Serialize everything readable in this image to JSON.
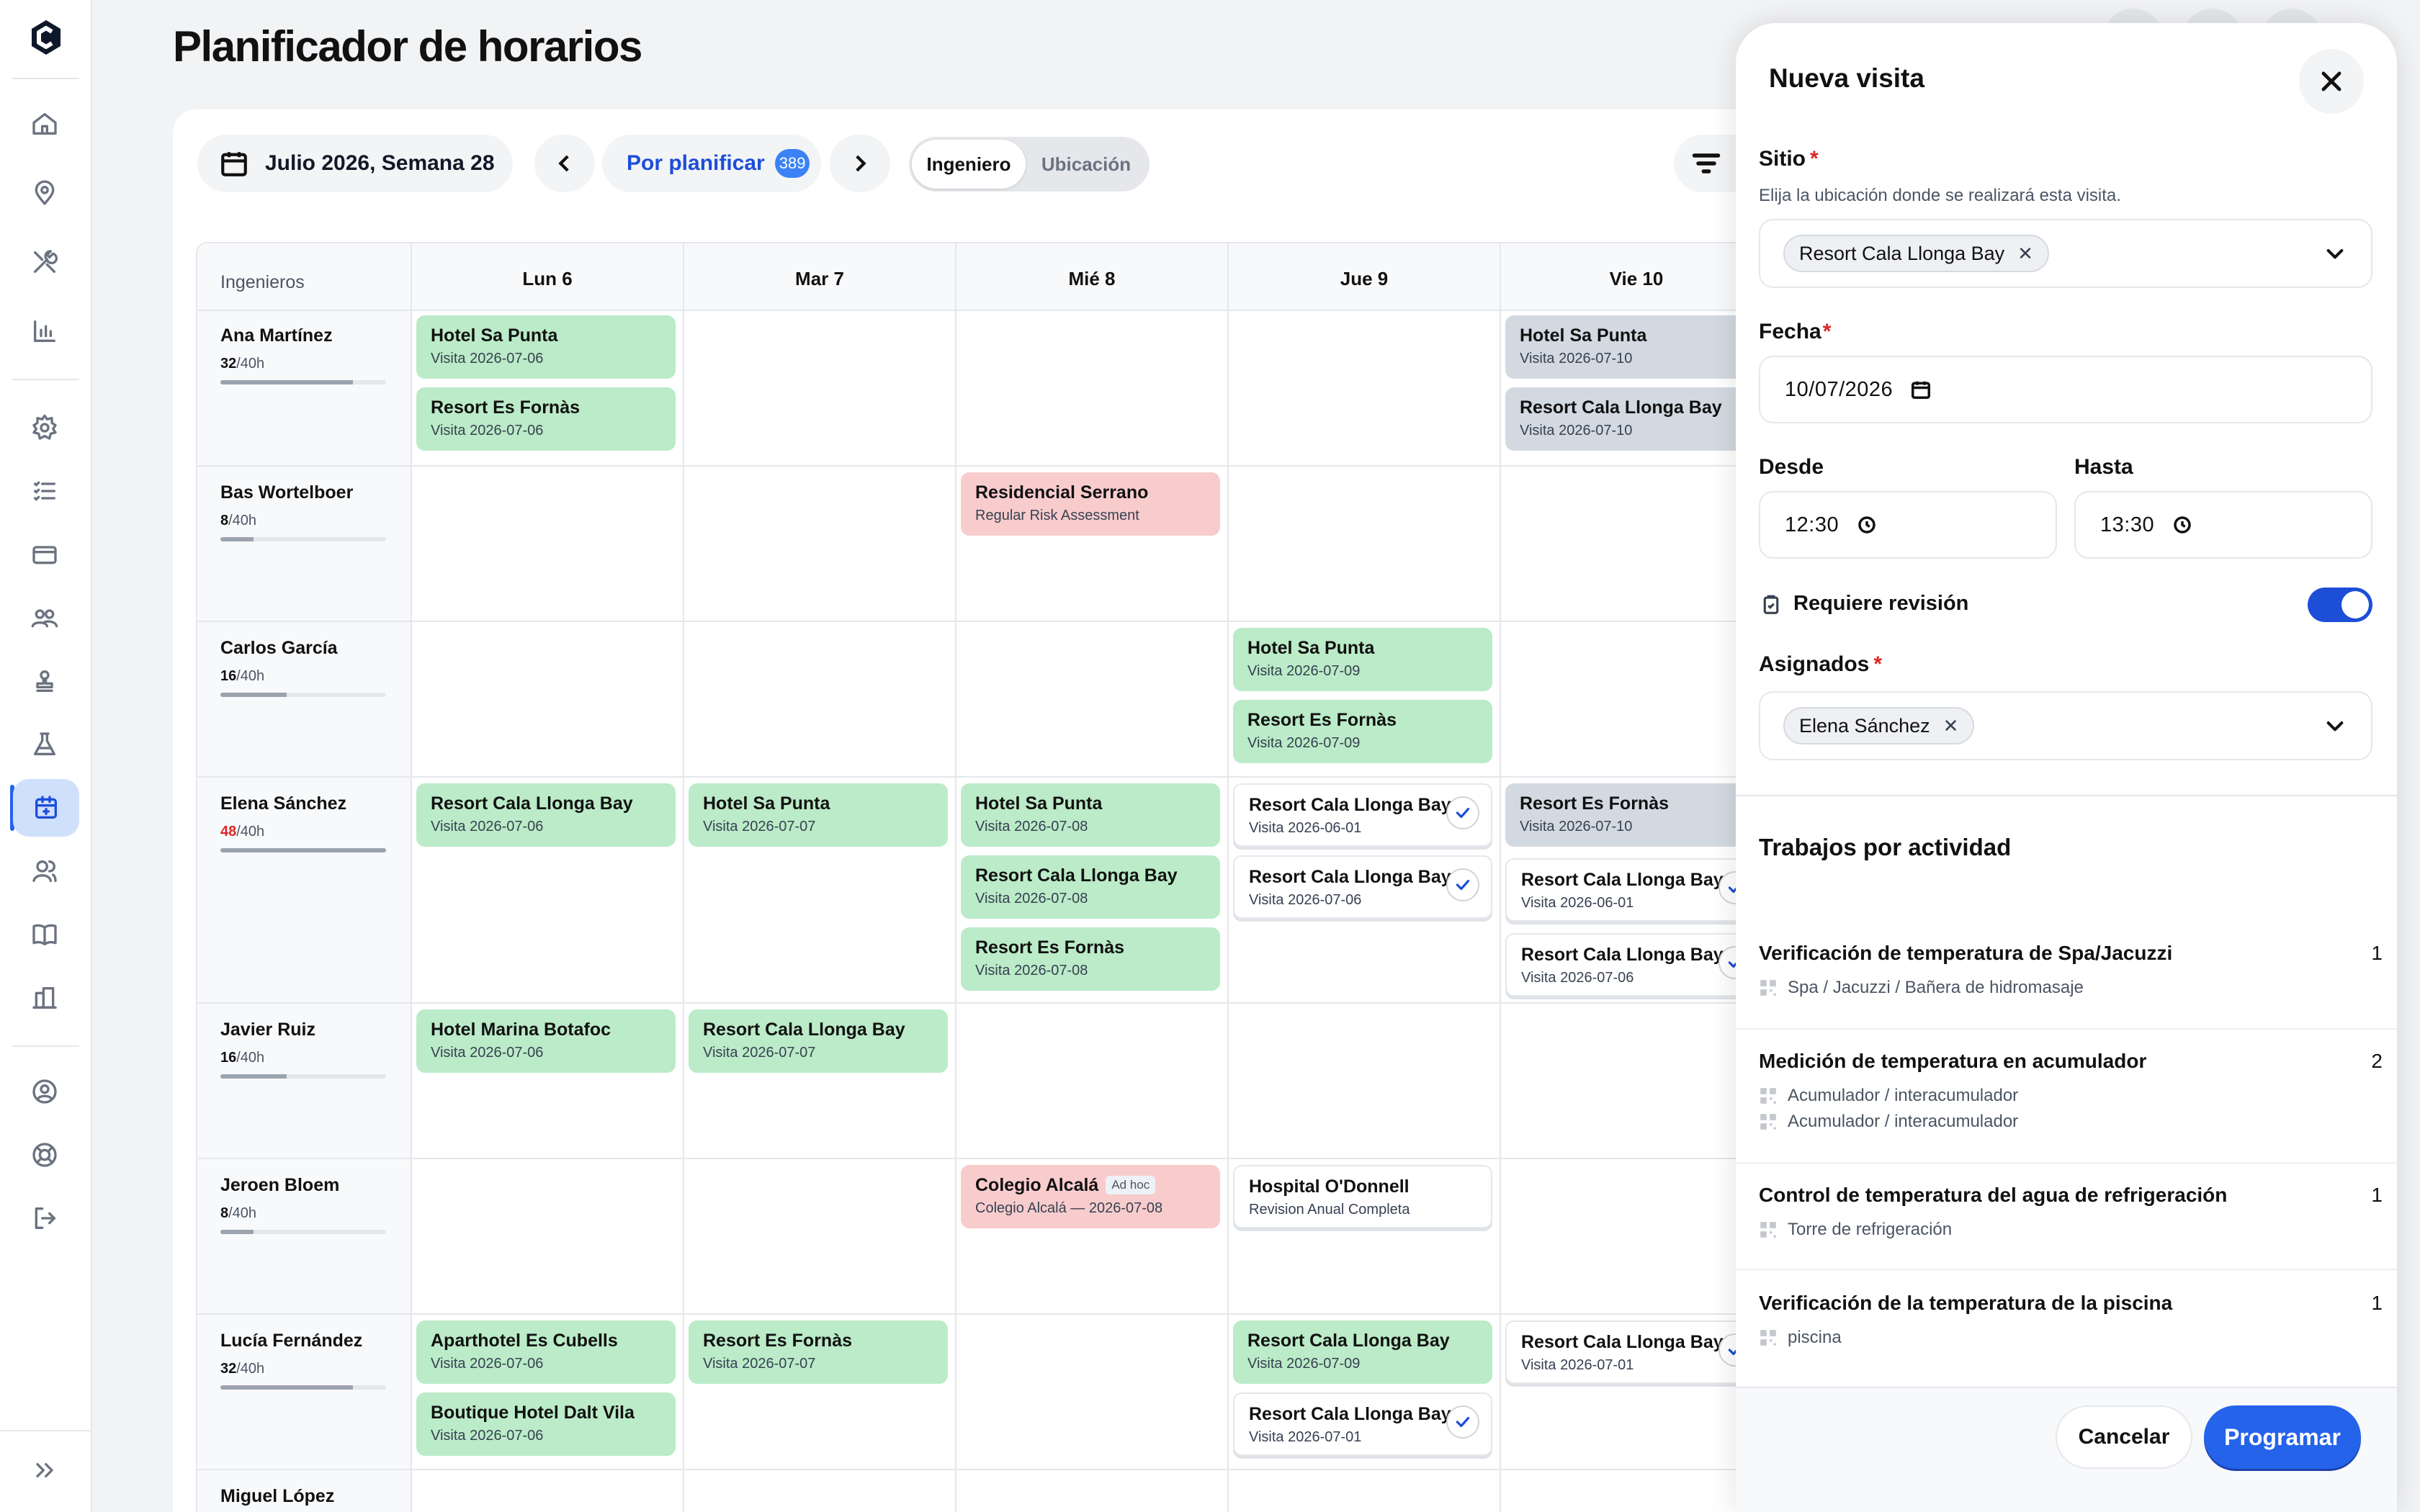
{
  "page": {
    "title": "Planificador de horarios"
  },
  "toolbar": {
    "week_label": "Julio 2026, Semana 28",
    "unplanned_label": "Por planificar",
    "unplanned_count": "389",
    "view_engineer": "Ingeniero",
    "view_location": "Ubicación"
  },
  "grid": {
    "engineers_header": "Ingenieros",
    "days": [
      "Lun 6",
      "Mar 7",
      "Mié 8",
      "Jue 9",
      "Vie 10"
    ],
    "engineers": [
      {
        "name": "Ana Martínez",
        "hours": "32",
        "capacity": "/40h",
        "load": 0.8
      },
      {
        "name": "Bas Wortelboer",
        "hours": "8",
        "capacity": "/40h",
        "load": 0.2
      },
      {
        "name": "Carlos García",
        "hours": "16",
        "capacity": "/40h",
        "load": 0.4
      },
      {
        "name": "Elena Sánchez",
        "hours": "48",
        "capacity": "/40h",
        "load": 1.0,
        "over": true
      },
      {
        "name": "Javier Ruiz",
        "hours": "16",
        "capacity": "/40h",
        "load": 0.4
      },
      {
        "name": "Jeroen Bloem",
        "hours": "8",
        "capacity": "/40h",
        "load": 0.2
      },
      {
        "name": "Lucía Fernández",
        "hours": "32",
        "capacity": "/40h",
        "load": 0.8
      },
      {
        "name": "Miguel López",
        "hours": "",
        "capacity": "",
        "load": 0
      }
    ],
    "cards": [
      {
        "title": "Hotel Sa Punta",
        "sub": "Visita 2026-07-06",
        "color": "green"
      },
      {
        "title": "Resort Es Fornàs",
        "sub": "Visita 2026-07-06",
        "color": "green"
      },
      {
        "title": "Hotel Sa Punta",
        "sub": "Visita 2026-07-10",
        "color": "gray"
      },
      {
        "title": "Resort Cala Llonga Bay",
        "sub": "Visita 2026-07-10",
        "color": "gray"
      },
      {
        "title": "Residencial Serrano",
        "sub": "Regular Risk Assessment",
        "color": "red"
      },
      {
        "title": "Hotel Sa Punta",
        "sub": "Visita 2026-07-09",
        "color": "green"
      },
      {
        "title": "Resort Es Fornàs",
        "sub": "Visita 2026-07-09",
        "color": "green"
      },
      {
        "title": "Resort Cala Llonga Bay",
        "sub": "Visita 2026-07-06",
        "color": "green"
      },
      {
        "title": "Hotel Sa Punta",
        "sub": "Visita 2026-07-07",
        "color": "green"
      },
      {
        "title": "Hotel Sa Punta",
        "sub": "Visita 2026-07-08",
        "color": "green"
      },
      {
        "title": "Resort Cala Llonga Bay",
        "sub": "Visita 2026-07-08",
        "color": "green"
      },
      {
        "title": "Resort Es Fornàs",
        "sub": "Visita 2026-07-08",
        "color": "green"
      },
      {
        "title": "Resort Cala Llonga Bay",
        "sub": "Visita 2026-06-01",
        "color": "white",
        "check": true
      },
      {
        "title": "Resort Cala Llonga Bay",
        "sub": "Visita 2026-07-06",
        "color": "white",
        "check": true
      },
      {
        "title": "Resort Es Fornàs",
        "sub": "Visita 2026-07-10",
        "color": "gray"
      },
      {
        "title": "Resort Cala Llonga Bay",
        "sub": "Visita 2026-06-01",
        "color": "white",
        "check": true
      },
      {
        "title": "Resort Cala Llonga Bay",
        "sub": "Visita 2026-07-06",
        "color": "white",
        "check": true
      },
      {
        "title": "Hotel Marina Botafoc",
        "sub": "Visita 2026-07-06",
        "color": "green"
      },
      {
        "title": "Resort Cala Llonga Bay",
        "sub": "Visita 2026-07-07",
        "color": "green"
      },
      {
        "title": "Colegio Alcalá",
        "sub": "Colegio Alcalá — 2026-07-08",
        "color": "red",
        "badge": "Ad hoc"
      },
      {
        "title": "Hospital O'Donnell",
        "sub": "Revision Anual Completa",
        "color": "white"
      },
      {
        "title": "Aparthotel Es Cubells",
        "sub": "Visita 2026-07-06",
        "color": "green"
      },
      {
        "title": "Resort Es Fornàs",
        "sub": "Visita 2026-07-07",
        "color": "green"
      },
      {
        "title": "Resort Cala Llonga Bay",
        "sub": "Visita 2026-07-09",
        "color": "green"
      },
      {
        "title": "Resort Cala Llonga Bay",
        "sub": "Visita 2026-07-01",
        "color": "white",
        "check": true
      },
      {
        "title": "Boutique Hotel Dalt Vila",
        "sub": "Visita 2026-07-06",
        "color": "green"
      },
      {
        "title": "Resort Cala Llonga Bay",
        "sub": "Visita 2026-07-01",
        "color": "white",
        "check": true
      }
    ]
  },
  "drawer": {
    "title": "Nueva visita",
    "site_label": "Sitio",
    "site_help": "Elija la ubicación donde se realizará esta visita.",
    "site_value": "Resort Cala Llonga Bay",
    "date_label": "Fecha",
    "date_value": "10/07/2026",
    "from_label": "Desde",
    "from_value": "12:30",
    "to_label": "Hasta",
    "to_value": "13:30",
    "review_label": "Requiere revisión",
    "review_on": true,
    "assigned_label": "Asignados",
    "assigned_value": "Elena Sánchez",
    "activities_title": "Trabajos por actividad",
    "activities": [
      {
        "title": "Verificación de temperatura de Spa/Jacuzzi",
        "count": "1",
        "items": [
          "Spa / Jacuzzi / Bañera de hidromasaje"
        ]
      },
      {
        "title": "Medición de temperatura en acumulador",
        "count": "2",
        "items": [
          "Acumulador / interacumulador",
          "Acumulador / interacumulador"
        ]
      },
      {
        "title": "Control de temperatura del agua de refrigeración",
        "count": "1",
        "items": [
          "Torre de refrigeración"
        ]
      },
      {
        "title": "Verificación de la temperatura de la piscina",
        "count": "1",
        "items": [
          "piscina"
        ]
      }
    ],
    "cancel_label": "Cancelar",
    "submit_label": "Programar"
  },
  "colors": {
    "accent": "#2563eb",
    "green_card": "#bbebc8",
    "gray_card": "#d3d9e1",
    "red_card": "#f8cccd"
  },
  "icons": [
    "home-icon",
    "map-pin-icon",
    "tools-icon",
    "bar-chart-icon",
    "gear-icon",
    "checklist-icon",
    "credit-card-icon",
    "users-group-icon",
    "stamp-icon",
    "flask-icon",
    "calendar-icon",
    "user-icon",
    "book-icon",
    "building-icon",
    "user-circle-icon",
    "lifebuoy-icon",
    "logout-icon",
    "expand-icon"
  ]
}
